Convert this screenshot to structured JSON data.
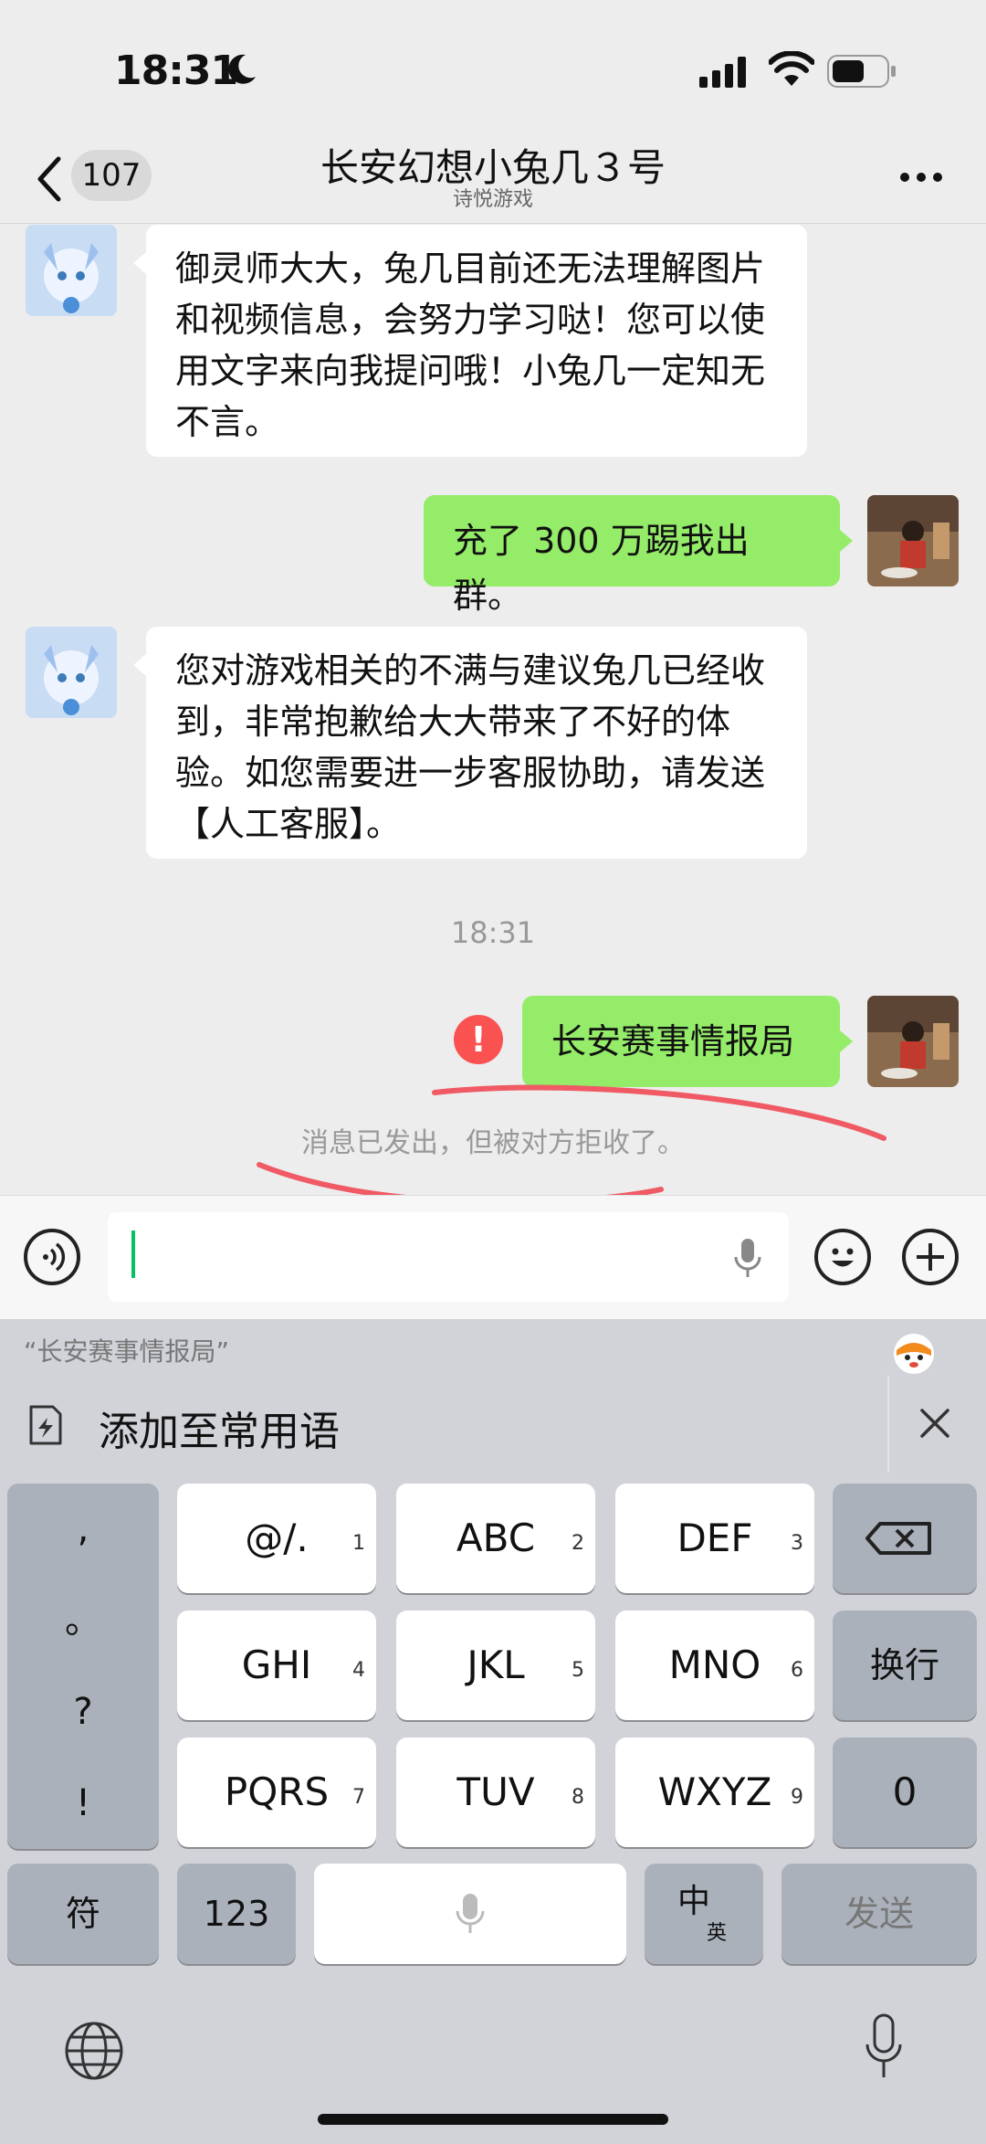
{
  "status_bar": {
    "time": "18:31"
  },
  "nav": {
    "unread_count": "107",
    "title": "长安幻想小兔几３号",
    "subtitle": "诗悦游戏"
  },
  "messages": [
    {
      "side": "left",
      "text": "御灵师大大，兔几目前还无法理解图片和视频信息，会努力学习哒！您可以使用文字来向我提问哦！小兔几一定知无不言。"
    },
    {
      "side": "right",
      "text": "充了 300 万踢我出群。"
    },
    {
      "side": "left",
      "text": "您对游戏相关的不满与建议兔几已经收到，非常抱歉给大大带来了不好的体验。如您需要进一步客服协助，请发送【人工客服】。"
    },
    {
      "side": "right",
      "text": "长安赛事情报局",
      "failed": true
    }
  ],
  "timestamp": "18:31",
  "error_mark": "!",
  "rejected_notice": "消息已发出，但被对方拒收了。",
  "suggestion": {
    "quote": "“长安赛事情报局”",
    "add_phrase_label": "添加至常用语"
  },
  "keyboard": {
    "punct": [
      ",",
      "。",
      "?",
      "!"
    ],
    "rows": [
      [
        {
          "label": "@/.",
          "num": "1"
        },
        {
          "label": "ABC",
          "num": "2"
        },
        {
          "label": "DEF",
          "num": "3"
        }
      ],
      [
        {
          "label": "GHI",
          "num": "4"
        },
        {
          "label": "JKL",
          "num": "5"
        },
        {
          "label": "MNO",
          "num": "6"
        }
      ],
      [
        {
          "label": "PQRS",
          "num": "7"
        },
        {
          "label": "TUV",
          "num": "8"
        },
        {
          "label": "WXYZ",
          "num": "9"
        }
      ]
    ],
    "newline_label": "换行",
    "zero_label": "0",
    "symbols_label": "符",
    "numbers_label": "123",
    "lang_main": "中",
    "lang_sub": "英",
    "send_label": "发送"
  },
  "colors": {
    "bubble_right": "#95ec69",
    "error_red": "#fa5151",
    "cursor_green": "#07c160",
    "annotation_red": "#f05a64"
  },
  "icons": [
    "moon-icon",
    "signal-icon",
    "wifi-icon",
    "battery-icon",
    "back-icon",
    "more-icon",
    "voice-icon",
    "mic-icon",
    "emoji-icon",
    "plus-icon",
    "add-phrase-icon",
    "close-icon",
    "backspace-icon",
    "globe-icon",
    "dictation-icon"
  ]
}
